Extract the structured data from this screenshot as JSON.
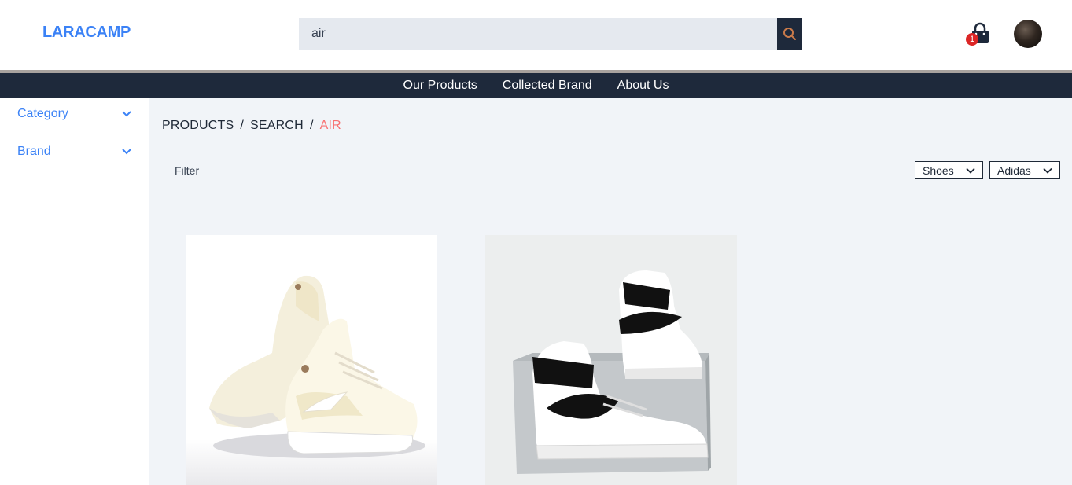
{
  "brand": {
    "logo_text": "LARACAMP",
    "accent_color": "#3b82f6"
  },
  "search": {
    "value": "air",
    "button_icon": "search-icon"
  },
  "cart": {
    "count": "1",
    "icon": "shopping-bag-icon",
    "badge_color": "#dc2626"
  },
  "nav": {
    "items": [
      {
        "label": "Our Products"
      },
      {
        "label": "Collected Brand"
      },
      {
        "label": "About Us"
      }
    ]
  },
  "sidebar": {
    "items": [
      {
        "label": "Category"
      },
      {
        "label": "Brand"
      }
    ]
  },
  "breadcrumb": {
    "items": [
      "PRODUCTS",
      "SEARCH",
      "AIR"
    ],
    "separator": "/"
  },
  "filter": {
    "label": "Filter",
    "category_selected": "Shoes",
    "brand_selected": "Adidas"
  },
  "products": [
    {
      "image": "cream-white-low-top-sneaker"
    },
    {
      "image": "white-black-high-top-sneakers-on-box"
    }
  ]
}
